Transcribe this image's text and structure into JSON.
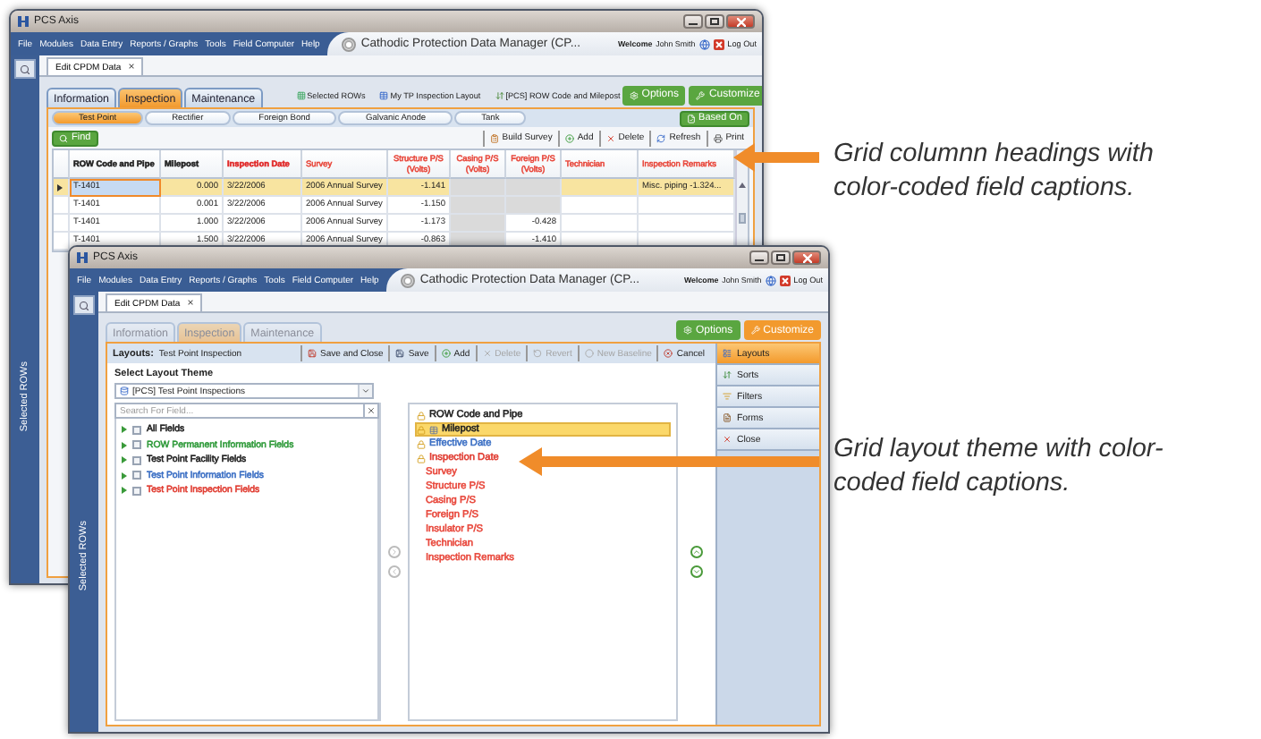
{
  "grid_window": {
    "title": "PCS Axis",
    "menu": [
      "File",
      "Modules",
      "Data Entry",
      "Reports / Graphs",
      "Tools",
      "Field Computer",
      "Help"
    ],
    "app_title": "Cathodic Protection Data Manager (CP...",
    "welcome": "Welcome",
    "user": "John Smith",
    "logout": "Log Out",
    "doc_tab": "Edit CPDM Data",
    "doc_tab_close": "×",
    "sidebar_label": "Selected ROWs",
    "tabs": [
      {
        "label": "Information",
        "selected": false
      },
      {
        "label": "Inspection",
        "selected": true
      },
      {
        "label": "Maintenance",
        "selected": false
      }
    ],
    "links": [
      "Selected ROWs",
      "My TP Inspection Layout",
      "[PCS] ROW Code and Milepost"
    ],
    "options": "Options",
    "customize": "Customize",
    "subtabs": [
      {
        "label": "Test Point",
        "selected": true
      },
      {
        "label": "Rectifier",
        "selected": false
      },
      {
        "label": "Foreign Bond",
        "selected": false
      },
      {
        "label": "Galvanic Anode",
        "selected": false
      },
      {
        "label": "Tank",
        "selected": false
      }
    ],
    "based_on": "Based On",
    "find": "Find",
    "actions": [
      "Build Survey",
      "Add",
      "Delete",
      "Refresh",
      "Print"
    ],
    "columns": [
      {
        "label": "ROW Code and Pipe",
        "color": "#222222",
        "kind": "text"
      },
      {
        "label": "Milepost",
        "color": "#222222",
        "kind": "number"
      },
      {
        "label": "Inspection Date",
        "color": "#e02828",
        "kind": "text"
      },
      {
        "label": "Survey",
        "color": "#e8483c",
        "kind": "text"
      },
      {
        "label": "Structure P/S (Volts)",
        "color": "#e8483c",
        "kind": "reading"
      },
      {
        "label": "Casing P/S (Volts)",
        "color": "#e8483c",
        "kind": "reading"
      },
      {
        "label": "Foreign P/S (Volts)",
        "color": "#e8483c",
        "kind": "reading"
      },
      {
        "label": "Technician",
        "color": "#e8483c",
        "kind": "text"
      },
      {
        "label": "Inspection Remarks",
        "color": "#e8483c",
        "kind": "text"
      }
    ],
    "rows": [
      {
        "selected": true,
        "cells": [
          "T-1401",
          "0.000",
          "3/22/2006",
          "2006 Annual Survey",
          "-1.141",
          null,
          null,
          null,
          "Misc. piping -1.324..."
        ]
      },
      {
        "selected": false,
        "cells": [
          "T-1401",
          "0.001",
          "3/22/2006",
          "2006 Annual Survey",
          "-1.150",
          null,
          null,
          null,
          null
        ]
      },
      {
        "selected": false,
        "cells": [
          "T-1401",
          "1.000",
          "3/22/2006",
          "2006 Annual Survey",
          "-1.173",
          null,
          "-0.428",
          null,
          null
        ]
      },
      {
        "selected": false,
        "cells": [
          "T-1401",
          "1.500",
          "3/22/2006",
          "2006 Annual Survey",
          "-0.863",
          null,
          "-1.410",
          null,
          null
        ]
      }
    ]
  },
  "layout_window": {
    "title": "PCS Axis",
    "menu": [
      "File",
      "Modules",
      "Data Entry",
      "Reports / Graphs",
      "Tools",
      "Field Computer",
      "Help"
    ],
    "app_title": "Cathodic Protection Data Manager (CP...",
    "welcome": "Welcome",
    "user": "John Smith",
    "logout": "Log Out",
    "doc_tab": "Edit CPDM Data",
    "doc_tab_close": "×",
    "sidebar_label": "Selected ROWs",
    "tabs": [
      {
        "label": "Information",
        "selected": false,
        "disabled": true
      },
      {
        "label": "Inspection",
        "selected": true,
        "disabled": true
      },
      {
        "label": "Maintenance",
        "selected": false,
        "disabled": true
      }
    ],
    "options": "Options",
    "customize": "Customize",
    "layouts_label": "Layouts:",
    "layout_name": "Test Point Inspection",
    "actions": [
      {
        "label": "Save and Close",
        "disabled": false
      },
      {
        "label": "Save",
        "disabled": false
      },
      {
        "label": "Add",
        "disabled": false
      },
      {
        "label": "Delete",
        "disabled": true
      },
      {
        "label": "Revert",
        "disabled": true
      },
      {
        "label": "New Baseline",
        "disabled": true
      },
      {
        "label": "Cancel",
        "disabled": false
      }
    ],
    "side_menu": [
      {
        "label": "Layouts",
        "selected": true
      },
      {
        "label": "Sorts",
        "selected": false
      },
      {
        "label": "Filters",
        "selected": false
      },
      {
        "label": "Forms",
        "selected": false
      },
      {
        "label": "Close",
        "selected": false
      }
    ],
    "theme_label": "Select Layout Theme",
    "theme_value": "[PCS] Test Point Inspections",
    "field_search": {
      "placeholder": "Search For Field..."
    },
    "field_groups": [
      {
        "label": "All Fields",
        "color": "#222222",
        "checked": false
      },
      {
        "label": "ROW Permanent Information Fields",
        "color": "#2f9a3a",
        "checked": false
      },
      {
        "label": "Test Point Facility Fields",
        "color": "#222222",
        "checked": false
      },
      {
        "label": "Test Point Information Fields",
        "color": "#3b6fc4",
        "checked": false
      },
      {
        "label": "Test Point Inspection Fields",
        "color": "#e03c31",
        "checked": false
      }
    ],
    "layout_fields": [
      {
        "label": "ROW Code and Pipe",
        "locked": true,
        "selected": false
      },
      {
        "label": "Milepost",
        "locked": true,
        "selected": true
      },
      {
        "label": "Effective Date",
        "color": "#3b6fc4",
        "locked": true,
        "selected": false
      },
      {
        "label": "Inspection Date",
        "color": "#e03c31",
        "locked": true,
        "selected": false
      },
      {
        "label": "Survey",
        "color": "#e8483c",
        "locked": false,
        "selected": false
      },
      {
        "label": "Structure P/S",
        "color": "#e8483c",
        "locked": false,
        "selected": false
      },
      {
        "label": "Casing P/S",
        "color": "#e8483c",
        "locked": false,
        "selected": false
      },
      {
        "label": "Foreign P/S",
        "color": "#e8483c",
        "locked": false,
        "selected": false
      },
      {
        "label": "Insulator P/S",
        "color": "#e8483c",
        "locked": false,
        "selected": false
      },
      {
        "label": "Technician",
        "color": "#e8483c",
        "locked": false,
        "selected": false
      },
      {
        "label": "Inspection Remarks",
        "color": "#e8483c",
        "locked": false,
        "selected": false
      }
    ]
  },
  "callouts": [
    {
      "text": "Grid columnn headings with color-coded field captions."
    },
    {
      "text": "Grid layout theme with color-coded field captions."
    }
  ]
}
